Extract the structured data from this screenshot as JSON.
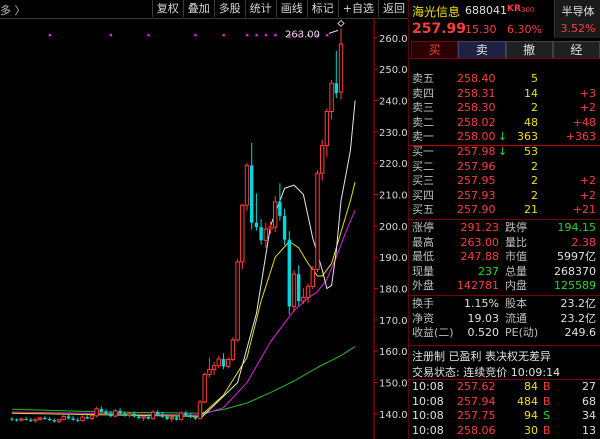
{
  "toolbar": {
    "left_label": "多 〉",
    "buttons": [
      "复权",
      "叠加",
      "多股",
      "统计",
      "画线",
      "标记",
      "+自选",
      "返回"
    ]
  },
  "header": {
    "name": "海光信息",
    "code": "688041",
    "tag": "KR",
    "tag2": "300",
    "sector": "半导体",
    "sector_pct": "3.52%",
    "price": "257.99",
    "change": "15.30",
    "change_pct": "6.30%"
  },
  "trade_buttons": [
    "买",
    "卖",
    "撤",
    "经"
  ],
  "sell_orders": [
    {
      "label": "卖五",
      "price": "258.40",
      "vol": "5",
      "chg": ""
    },
    {
      "label": "卖四",
      "price": "258.31",
      "vol": "14",
      "chg": "+3"
    },
    {
      "label": "卖三",
      "price": "258.30",
      "vol": "2",
      "chg": "+2"
    },
    {
      "label": "卖二",
      "price": "258.02",
      "vol": "48",
      "chg": "+48"
    },
    {
      "label": "卖一",
      "price": "258.00",
      "vol": "363",
      "chg": "+363",
      "arrow": "↓"
    }
  ],
  "buy_orders": [
    {
      "label": "买一",
      "price": "257.98",
      "vol": "53",
      "chg": "",
      "arrow": "↓"
    },
    {
      "label": "买二",
      "price": "257.96",
      "vol": "2",
      "chg": ""
    },
    {
      "label": "买三",
      "price": "257.95",
      "vol": "2",
      "chg": "+2"
    },
    {
      "label": "买四",
      "price": "257.93",
      "vol": "2",
      "chg": "+2"
    },
    {
      "label": "买五",
      "price": "257.90",
      "vol": "21",
      "chg": "+21"
    }
  ],
  "stats": [
    [
      {
        "k": "涨停",
        "v": "291.23",
        "c": "red"
      },
      {
        "k": "跌停",
        "v": "194.15",
        "c": "green"
      }
    ],
    [
      {
        "k": "最高",
        "v": "263.00",
        "c": "red"
      },
      {
        "k": "量比",
        "v": "2.38",
        "c": "red"
      }
    ],
    [
      {
        "k": "最低",
        "v": "247.88",
        "c": "red"
      },
      {
        "k": "市值",
        "v": "5997亿",
        "c": "white"
      }
    ],
    [
      {
        "k": "现量",
        "v": "237",
        "c": "green"
      },
      {
        "k": "总量",
        "v": "268370",
        "c": "white"
      }
    ],
    [
      {
        "k": "外盘",
        "v": "142781",
        "c": "red"
      },
      {
        "k": "内盘",
        "v": "125589",
        "c": "green"
      }
    ]
  ],
  "stats2": [
    [
      {
        "k": "换手",
        "v": "1.15%",
        "c": "white"
      },
      {
        "k": "股本",
        "v": "23.2亿",
        "c": "white"
      }
    ],
    [
      {
        "k": "净资",
        "v": "19.03",
        "c": "white"
      },
      {
        "k": "流通",
        "v": "23.2亿",
        "c": "white"
      }
    ],
    [
      {
        "k": "收益(二)",
        "v": "0.520",
        "c": "white"
      },
      {
        "k": "PE(动)",
        "v": "249.6",
        "c": "white"
      }
    ]
  ],
  "notes": {
    "line1": "注册制 已盈利 表决权无差异",
    "line2": "交易状态: 连续竞价 10:09:14"
  },
  "ticks": [
    {
      "t": "10:08",
      "p": "257.62",
      "v": "84",
      "s": "B",
      "n": "27"
    },
    {
      "t": "10:08",
      "p": "257.94",
      "v": "484",
      "s": "B",
      "n": "68"
    },
    {
      "t": "10:08",
      "p": "257.75",
      "v": "94",
      "s": "S",
      "n": "34"
    },
    {
      "t": "10:08",
      "p": "258.06",
      "v": "30",
      "s": "B",
      "n": "13"
    }
  ],
  "colors": {
    "up": "#ff3c3c",
    "down": "#00d8d8",
    "ma_white": "#e8e8e8",
    "ma_yellow": "#e8e000",
    "ma_magenta": "#e020e0",
    "ma_green": "#20c020",
    "axis": "#c00000",
    "label_red": "#ff3c3c",
    "label_green": "#25d82b"
  },
  "chart_data": {
    "type": "candlestick",
    "title": "",
    "xlabel": "",
    "ylabel": "",
    "ylim": [
      132,
      266
    ],
    "yticks": [
      140,
      150,
      160,
      170,
      180,
      190,
      200,
      210,
      220,
      230,
      240,
      250,
      260
    ],
    "annotation": "263.00",
    "candles": [
      [
        138.5,
        138.9,
        137.8,
        138.2
      ],
      [
        138.2,
        138.6,
        137.5,
        138.0
      ],
      [
        138.0,
        138.8,
        137.6,
        138.4
      ],
      [
        138.4,
        139.0,
        137.9,
        138.1
      ],
      [
        138.1,
        138.7,
        137.4,
        137.8
      ],
      [
        137.8,
        138.5,
        137.3,
        138.3
      ],
      [
        138.3,
        139.1,
        137.9,
        138.7
      ],
      [
        138.7,
        139.3,
        138.1,
        138.4
      ],
      [
        138.4,
        139.0,
        137.8,
        138.0
      ],
      [
        138.0,
        138.6,
        137.2,
        137.6
      ],
      [
        137.6,
        138.4,
        137.0,
        138.2
      ],
      [
        138.2,
        139.6,
        137.9,
        139.2
      ],
      [
        139.2,
        140.0,
        138.2,
        138.6
      ],
      [
        138.6,
        139.3,
        137.8,
        138.1
      ],
      [
        138.1,
        138.8,
        137.4,
        137.9
      ],
      [
        137.9,
        139.5,
        137.6,
        139.0
      ],
      [
        139.0,
        140.2,
        138.3,
        138.5
      ],
      [
        138.5,
        139.7,
        138.0,
        139.4
      ],
      [
        139.4,
        142.2,
        138.9,
        141.6
      ],
      [
        141.6,
        142.4,
        140.3,
        140.8
      ],
      [
        140.8,
        141.5,
        139.6,
        140.1
      ],
      [
        140.1,
        140.9,
        138.9,
        139.3
      ],
      [
        139.3,
        141.6,
        139.0,
        141.0
      ],
      [
        141.0,
        141.8,
        139.7,
        140.2
      ],
      [
        140.2,
        140.8,
        139.1,
        139.6
      ],
      [
        139.6,
        140.6,
        138.9,
        140.1
      ],
      [
        140.1,
        140.7,
        138.8,
        139.2
      ],
      [
        139.2,
        140.0,
        138.3,
        138.7
      ],
      [
        138.7,
        139.5,
        137.8,
        139.1
      ],
      [
        139.1,
        139.8,
        138.2,
        138.5
      ],
      [
        138.5,
        141.2,
        138.2,
        140.6
      ],
      [
        140.6,
        141.3,
        139.3,
        139.8
      ],
      [
        139.8,
        140.6,
        138.7,
        139.1
      ],
      [
        139.1,
        139.9,
        138.0,
        138.4
      ],
      [
        138.4,
        139.2,
        137.5,
        138.8
      ],
      [
        138.8,
        139.4,
        137.9,
        138.2
      ],
      [
        138.2,
        140.9,
        137.9,
        140.3
      ],
      [
        140.3,
        141.0,
        139.2,
        139.6
      ],
      [
        139.6,
        140.3,
        138.7,
        139.0
      ],
      [
        139.0,
        139.6,
        138.1,
        138.5
      ],
      [
        138.5,
        144.5,
        138.3,
        143.8
      ],
      [
        143.8,
        153.2,
        143.4,
        152.6
      ],
      [
        152.6,
        158.0,
        151.8,
        154.2
      ],
      [
        154.2,
        156.5,
        152.4,
        155.4
      ],
      [
        155.4,
        158.6,
        154.6,
        157.5
      ],
      [
        157.5,
        159.3,
        154.3,
        155.1
      ],
      [
        155.1,
        158.0,
        154.5,
        157.4
      ],
      [
        157.4,
        164.5,
        156.8,
        163.6
      ],
      [
        163.6,
        189.3,
        163.0,
        188.5
      ],
      [
        188.5,
        207.0,
        186.2,
        206.6
      ],
      [
        206.6,
        220.0,
        204.8,
        219.3
      ],
      [
        219.3,
        226.5,
        198.8,
        201.0
      ],
      [
        201.0,
        210.4,
        198.5,
        199.6
      ],
      [
        199.6,
        202.2,
        194.0,
        195.4
      ],
      [
        195.4,
        201.0,
        193.0,
        199.0
      ],
      [
        199.0,
        201.3,
        197.5,
        199.6
      ],
      [
        199.6,
        209.5,
        198.0,
        207.7
      ],
      [
        207.7,
        213.6,
        201.7,
        203.2
      ],
      [
        203.2,
        205.4,
        193.8,
        195.6
      ],
      [
        195.6,
        198.3,
        171.7,
        174.3
      ],
      [
        174.3,
        185.8,
        172.6,
        184.6
      ],
      [
        184.6,
        187.4,
        174.5,
        176.0
      ],
      [
        176.0,
        180.1,
        175.1,
        177.2
      ],
      [
        177.2,
        181.6,
        175.3,
        180.7
      ],
      [
        180.7,
        187.2,
        179.8,
        186.1
      ],
      [
        186.1,
        217.8,
        185.3,
        216.8
      ],
      [
        216.8,
        227.5,
        214.4,
        225.6
      ],
      [
        225.6,
        237.5,
        222.0,
        236.5
      ],
      [
        236.5,
        246.6,
        234.0,
        245.5
      ],
      [
        245.5,
        255.8,
        240.8,
        242.3
      ],
      [
        242.7,
        263.0,
        240.4,
        257.99
      ]
    ],
    "ma_white": [
      [
        40,
        138.4
      ],
      [
        48,
        150
      ],
      [
        52,
        172
      ],
      [
        55,
        200
      ],
      [
        58,
        212
      ],
      [
        60,
        213
      ],
      [
        62,
        210
      ],
      [
        64,
        196
      ],
      [
        66,
        186
      ],
      [
        67,
        180
      ],
      [
        68,
        181
      ],
      [
        69,
        192
      ],
      [
        70,
        208
      ],
      [
        72,
        224
      ],
      [
        73,
        240
      ]
    ],
    "ma_yellow": [
      [
        0,
        140.2
      ],
      [
        40,
        139.2
      ],
      [
        45,
        146
      ],
      [
        50,
        158
      ],
      [
        53,
        176
      ],
      [
        56,
        190
      ],
      [
        59,
        195
      ],
      [
        61,
        193
      ],
      [
        63,
        188
      ],
      [
        65,
        184
      ],
      [
        66,
        184
      ],
      [
        68,
        188
      ],
      [
        70,
        198
      ],
      [
        72,
        208
      ],
      [
        73,
        214
      ]
    ],
    "ma_magenta": [
      [
        0,
        140.6
      ],
      [
        40,
        139.6
      ],
      [
        45,
        142
      ],
      [
        50,
        150
      ],
      [
        55,
        163
      ],
      [
        60,
        173
      ],
      [
        63,
        177
      ],
      [
        65,
        179
      ],
      [
        67,
        183
      ],
      [
        69,
        190
      ],
      [
        71,
        198
      ],
      [
        73,
        205
      ]
    ],
    "ma_green": [
      [
        0,
        141.5
      ],
      [
        20,
        140.6
      ],
      [
        40,
        140.2
      ],
      [
        45,
        141.4
      ],
      [
        50,
        143.5
      ],
      [
        55,
        146.8
      ],
      [
        60,
        150.5
      ],
      [
        65,
        154.8
      ],
      [
        70,
        158.6
      ],
      [
        73,
        161.5
      ]
    ],
    "markers_top": [
      8,
      21,
      29,
      39,
      45,
      50,
      52,
      54,
      56,
      59,
      61,
      63,
      65,
      67
    ]
  }
}
